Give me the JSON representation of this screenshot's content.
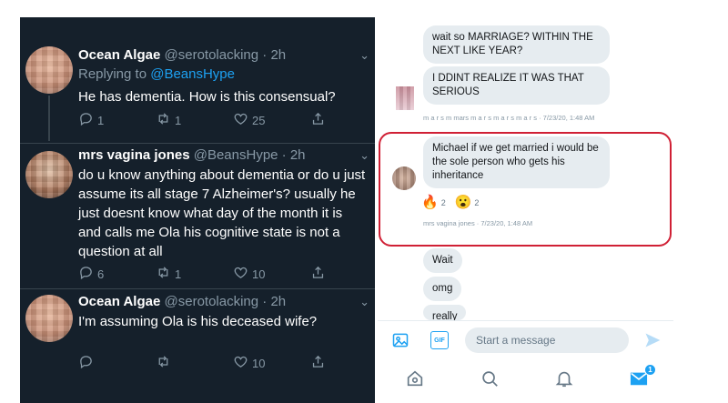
{
  "thread": {
    "tweets": [
      {
        "name": "Ocean Algae",
        "meta": "@serotolacking · 2h",
        "replying_prefix": "Replying to ",
        "replying_to": "@BeansHype",
        "text": "He has dementia. How is this consensual?",
        "replies": "1",
        "retweets": "1",
        "likes": "25"
      },
      {
        "name": "mrs vagina jones",
        "meta": "@BeansHype · 2h",
        "text": "do u know anything about dementia or do u just assume its all stage 7 Alzheimer's? usually he just doesnt know what day of the month it is and calls me Ola his cognitive state is not a question at all",
        "replies": "6",
        "retweets": "1",
        "likes": "10"
      },
      {
        "name": "Ocean Algae",
        "meta": "@serotolacking · 2h",
        "text": "I'm assuming Ola is his deceased wife?",
        "replies": "",
        "retweets": "",
        "likes": "10"
      }
    ]
  },
  "dm": {
    "messages": [
      {
        "text": "wait so MARRIAGE? WITHIN THE NEXT LIKE YEAR?"
      },
      {
        "text": "I DDINT REALIZE IT WAS THAT SERIOUS"
      },
      {
        "text": "Michael if we get married i would be the sole person who gets his inheritance"
      },
      {
        "text": "Wait"
      },
      {
        "text": "omg"
      },
      {
        "text": "really"
      }
    ],
    "meta_1": "m a r s m mars m a r s m a r s m a r s · 7/23/20, 1:48 AM",
    "meta_2": "mrs vagina jones · 7/23/20, 1:48 AM",
    "reactions": [
      {
        "emoji": "🔥",
        "count": "2"
      },
      {
        "emoji": "😮",
        "count": "2"
      }
    ],
    "composer": {
      "placeholder": "Start a message",
      "gif_label": "GIF"
    },
    "badge_count": "1"
  },
  "colors": {
    "twitter_dark_bg": "#15202b",
    "twitter_blue": "#1da1f2",
    "muted": "#8899a6",
    "highlight_red": "#d02035"
  },
  "icons": [
    "reply-icon",
    "retweet-icon",
    "like-icon",
    "share-icon",
    "chevron-down-icon",
    "image-icon",
    "gif-icon",
    "send-icon",
    "home-icon",
    "search-icon",
    "notifications-icon",
    "messages-icon"
  ]
}
